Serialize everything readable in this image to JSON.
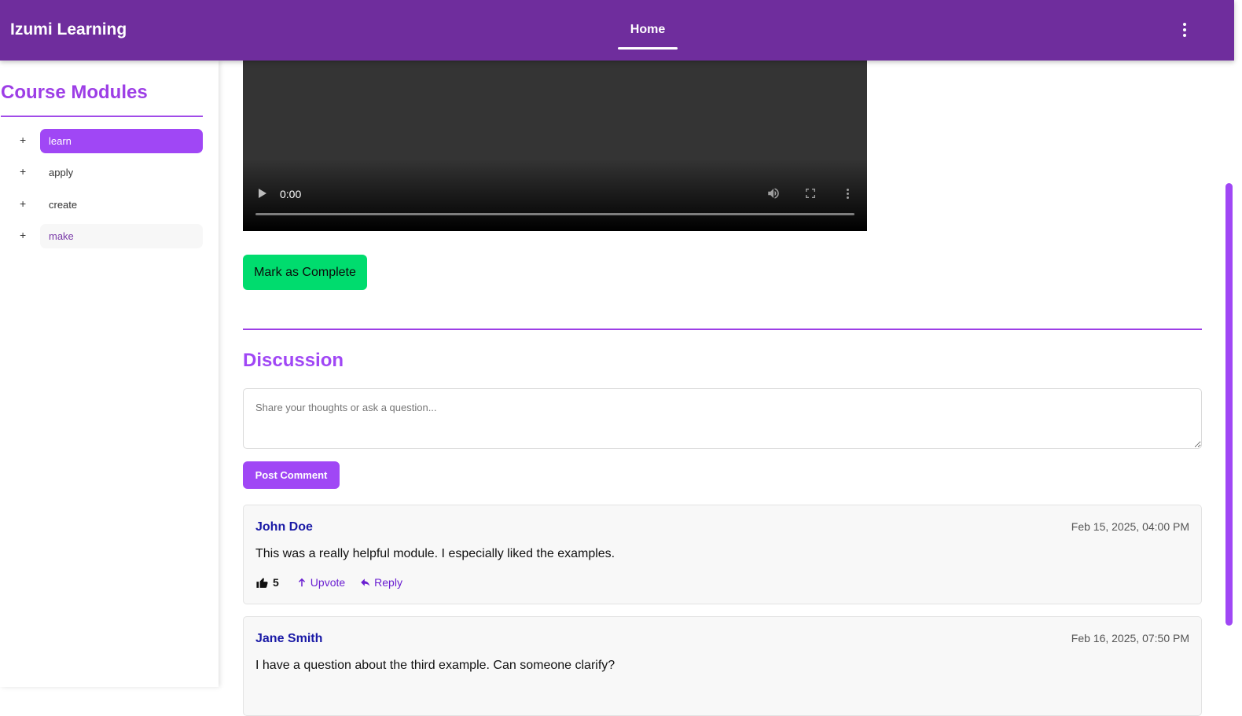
{
  "app": {
    "brand": "Izumi Learning",
    "nav_home": "Home"
  },
  "sidebar": {
    "title": "Course Modules",
    "modules": [
      {
        "label": "learn",
        "state": "active"
      },
      {
        "label": "apply",
        "state": "normal"
      },
      {
        "label": "create",
        "state": "normal"
      },
      {
        "label": "make",
        "state": "hover"
      }
    ],
    "expand_symbol": "+"
  },
  "video": {
    "time": "0:00",
    "progress_fraction": 0
  },
  "actions": {
    "complete_label": "Mark as Complete"
  },
  "discussion": {
    "title": "Discussion",
    "input_placeholder": "Share your thoughts or ask a question...",
    "post_label": "Post Comment",
    "upvote_label": "Upvote",
    "reply_label": "Reply",
    "comments": [
      {
        "author": "John Doe",
        "date": "Feb 15, 2025, 04:00 PM",
        "text": "This was a really helpful module. I especially liked the examples.",
        "likes": "5"
      },
      {
        "author": "Jane Smith",
        "date": "Feb 16, 2025, 07:50 PM",
        "text": "I have a question about the third example. Can someone clarify?",
        "likes": ""
      }
    ]
  },
  "colors": {
    "header": "#6f2d9d",
    "accent": "#a047f5",
    "complete": "#00dc6e",
    "author": "#1a1aa6"
  }
}
